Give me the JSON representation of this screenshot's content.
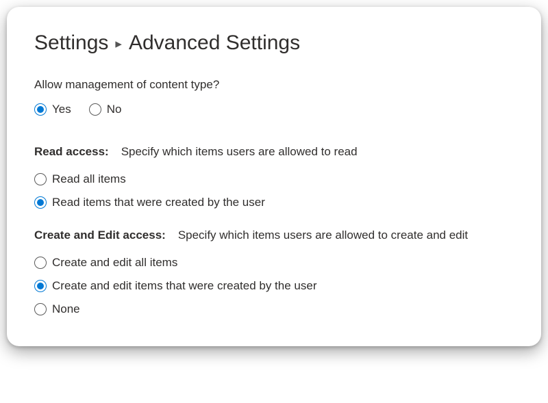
{
  "breadcrumb": {
    "parent": "Settings",
    "current": "Advanced Settings"
  },
  "contentType": {
    "question": "Allow management of content type?",
    "options": [
      {
        "label": "Yes",
        "selected": true
      },
      {
        "label": "No",
        "selected": false
      }
    ]
  },
  "readAccess": {
    "title": "Read access:",
    "description": "Specify which items users are allowed to read",
    "options": [
      {
        "label": "Read all items",
        "selected": false
      },
      {
        "label": "Read items that were created by the user",
        "selected": true
      }
    ]
  },
  "createEditAccess": {
    "title": "Create and Edit access:",
    "description": "Specify which items users are allowed to create and edit",
    "options": [
      {
        "label": "Create and edit all items",
        "selected": false
      },
      {
        "label": "Create and edit items that were created by the user",
        "selected": true
      },
      {
        "label": "None",
        "selected": false
      }
    ]
  }
}
